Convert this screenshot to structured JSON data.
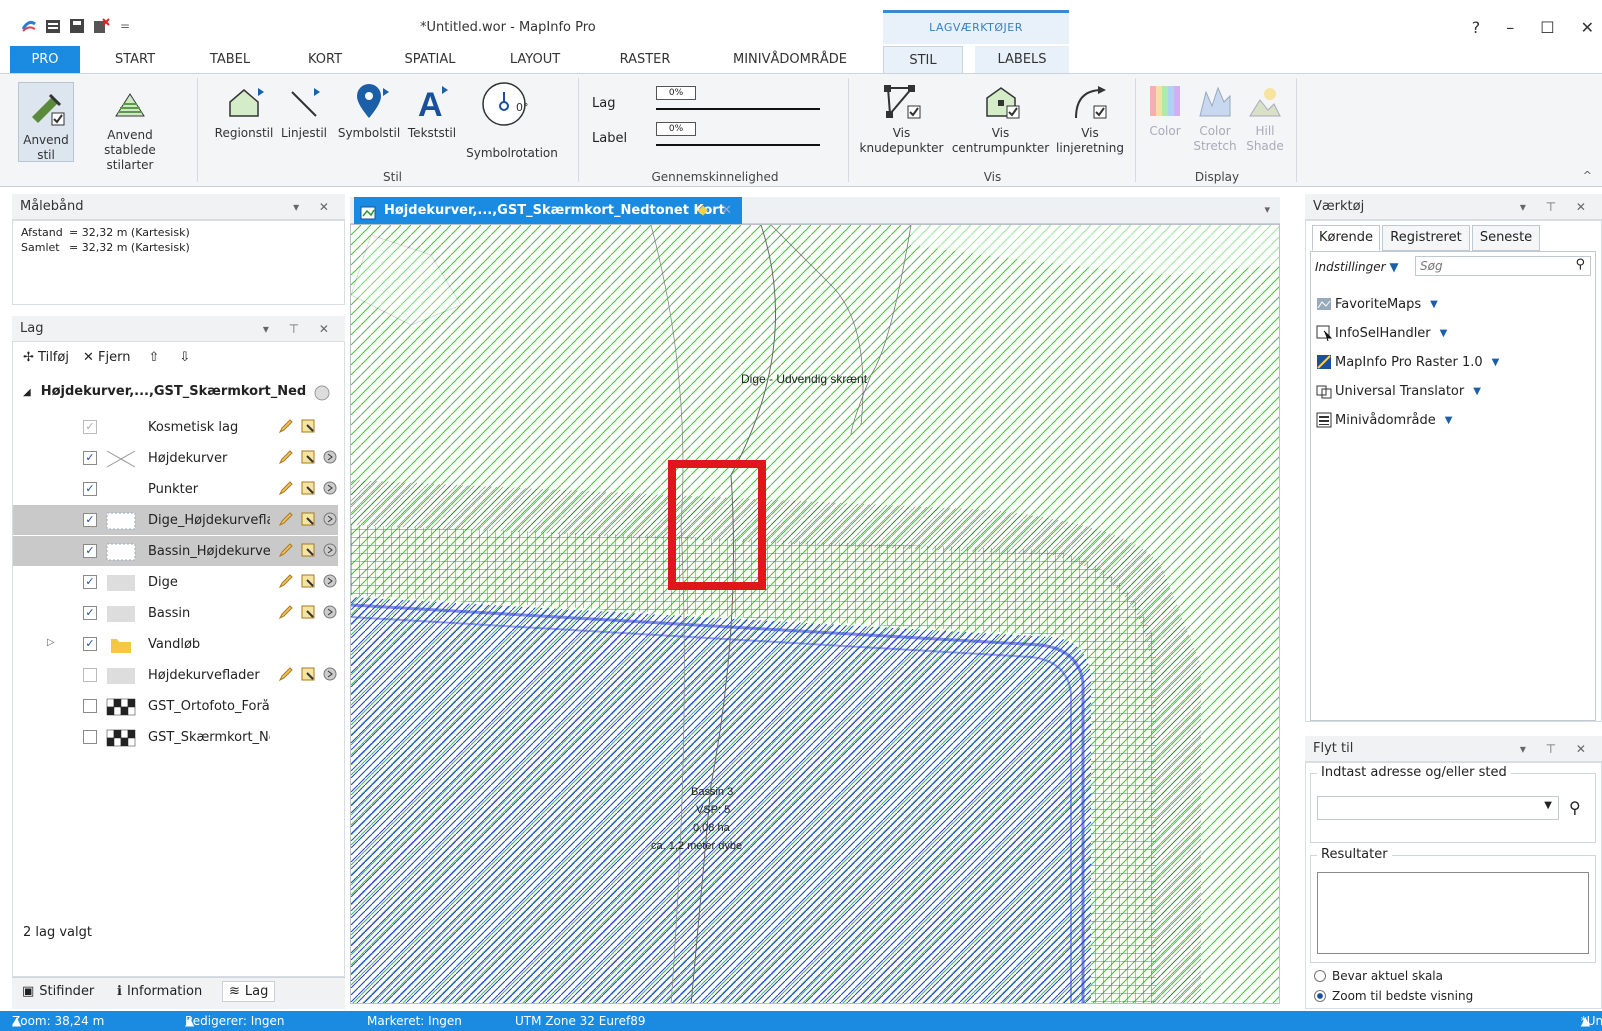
{
  "titlebar": {
    "title": "*Untitled.wor - MapInfo Pro",
    "context_group": "LAGVÆRKTØJER",
    "help": "?",
    "minimize": "–",
    "maximize": "☐",
    "close": "✕",
    "qat_more": "="
  },
  "tabs": [
    "PRO",
    "START",
    "TABEL",
    "KORT",
    "SPATIAL",
    "LAYOUT",
    "RASTER",
    "MINIVÅDOMRÅDE",
    "STIL",
    "LABELS"
  ],
  "ribbon": {
    "anvend_stil": "Anvend stil",
    "anvend_stablede": "Anvend stablede stilarter",
    "regionstil": "Regionstil",
    "linjestil": "Linjestil",
    "symbolstil": "Symbolstil",
    "tekststil": "Tekststil",
    "symbolrotation": "Symbolrotation",
    "rotation_value": "0°",
    "stil_group": "Stil",
    "lag_label": "Lag",
    "label_label": "Label",
    "lag_pct": "0%",
    "label_pct": "0%",
    "transp_group": "Gennemskinnelighed",
    "vis_knude_1": "Vis",
    "vis_knude_2": "knudepunkter",
    "vis_centrum_1": "Vis",
    "vis_centrum_2": "centrumpunkter",
    "vis_linje_1": "Vis",
    "vis_linje_2": "linjeretning",
    "vis_group": "Vis",
    "color": "Color",
    "color_stretch_1": "Color",
    "color_stretch_2": "Stretch",
    "hill_shade_1": "Hill",
    "hill_shade_2": "Shade",
    "display_group": "Display",
    "collapse": "^"
  },
  "malebaand": {
    "title": "Målebånd",
    "afstand_label": "Afstand",
    "afstand_value": "= 32,32 m (Kartesisk)",
    "samlet_label": "Samlet",
    "samlet_value": "= 32,32 m (Kartesisk)"
  },
  "lag": {
    "title": "Lag",
    "tilfoj": "Tilføj",
    "fjern": "Fjern",
    "group_name": "Højdekurver,...,GST_Skærmkort_Ned",
    "layers": [
      {
        "name": "Kosmetisk lag",
        "checked": true,
        "dim": true,
        "selected": false,
        "swatch": "none"
      },
      {
        "name": "Højdekurver",
        "checked": true,
        "dim": false,
        "selected": false,
        "swatch": "lines"
      },
      {
        "name": "Punkter",
        "checked": true,
        "dim": false,
        "selected": false,
        "swatch": "none"
      },
      {
        "name": "Dige_Højdekurvefla",
        "checked": true,
        "dim": false,
        "selected": true,
        "swatch": "dotted"
      },
      {
        "name": "Bassin_Højdekurvef",
        "checked": true,
        "dim": false,
        "selected": true,
        "swatch": "dotted"
      },
      {
        "name": "Dige",
        "checked": true,
        "dim": false,
        "selected": false,
        "swatch": "gray"
      },
      {
        "name": "Bassin",
        "checked": true,
        "dim": false,
        "selected": false,
        "swatch": "gray"
      },
      {
        "name": "Vandløb",
        "checked": true,
        "dim": false,
        "selected": false,
        "swatch": "folder"
      },
      {
        "name": "Højdekurveflader",
        "checked": false,
        "dim": true,
        "selected": false,
        "swatch": "gray"
      },
      {
        "name": "GST_Ortofoto_Forår",
        "checked": false,
        "dim": false,
        "selected": false,
        "swatch": "checker"
      },
      {
        "name": "GST_Skærmkort_Ne",
        "checked": false,
        "dim": false,
        "selected": false,
        "swatch": "checker"
      }
    ],
    "selected_count": "2 lag valgt"
  },
  "bottom_tabs": {
    "stifinder": "Stifinder",
    "information": "Information",
    "lag": "Lag"
  },
  "map": {
    "tab_title": "Højdekurver,...,GST_Skærmkort_Nedtonet Kort",
    "label_dige": "Dige - Udvendig skrænt",
    "label_bassin_1": "Bassin 3",
    "label_bassin_2": "VSP: 5",
    "label_bassin_3": "0,08 ha",
    "label_bassin_4": "ca. 1,2 meter dybe",
    "colors": {
      "green": "#2ecc2e",
      "blue": "#2b3fd6",
      "highlight": "#e0161c"
    }
  },
  "vaerktoj": {
    "title": "Værktøj",
    "tabs": [
      "Kørende",
      "Registreret",
      "Seneste"
    ],
    "indstillinger": "Indstillinger",
    "search_placeholder": "Søg",
    "items": [
      "FavoriteMaps",
      "InfoSelHandler",
      "MapInfo Pro Raster 1.0",
      "Universal Translator",
      "Minivådområde"
    ]
  },
  "flyttil": {
    "title": "Flyt til",
    "address_label": "Indtast adresse og/eller sted",
    "results_label": "Resultater",
    "radio1": "Bevar aktuel skala",
    "radio2": "Zoom til bedste visning"
  },
  "status": {
    "zoom": "Zoom: 38,24 m",
    "rediger": "Redigerer: Ingen",
    "markeret": "Markeret: Ingen",
    "projection": "UTM Zone 32 Euref89",
    "workspace": "*Untitled.wor"
  }
}
